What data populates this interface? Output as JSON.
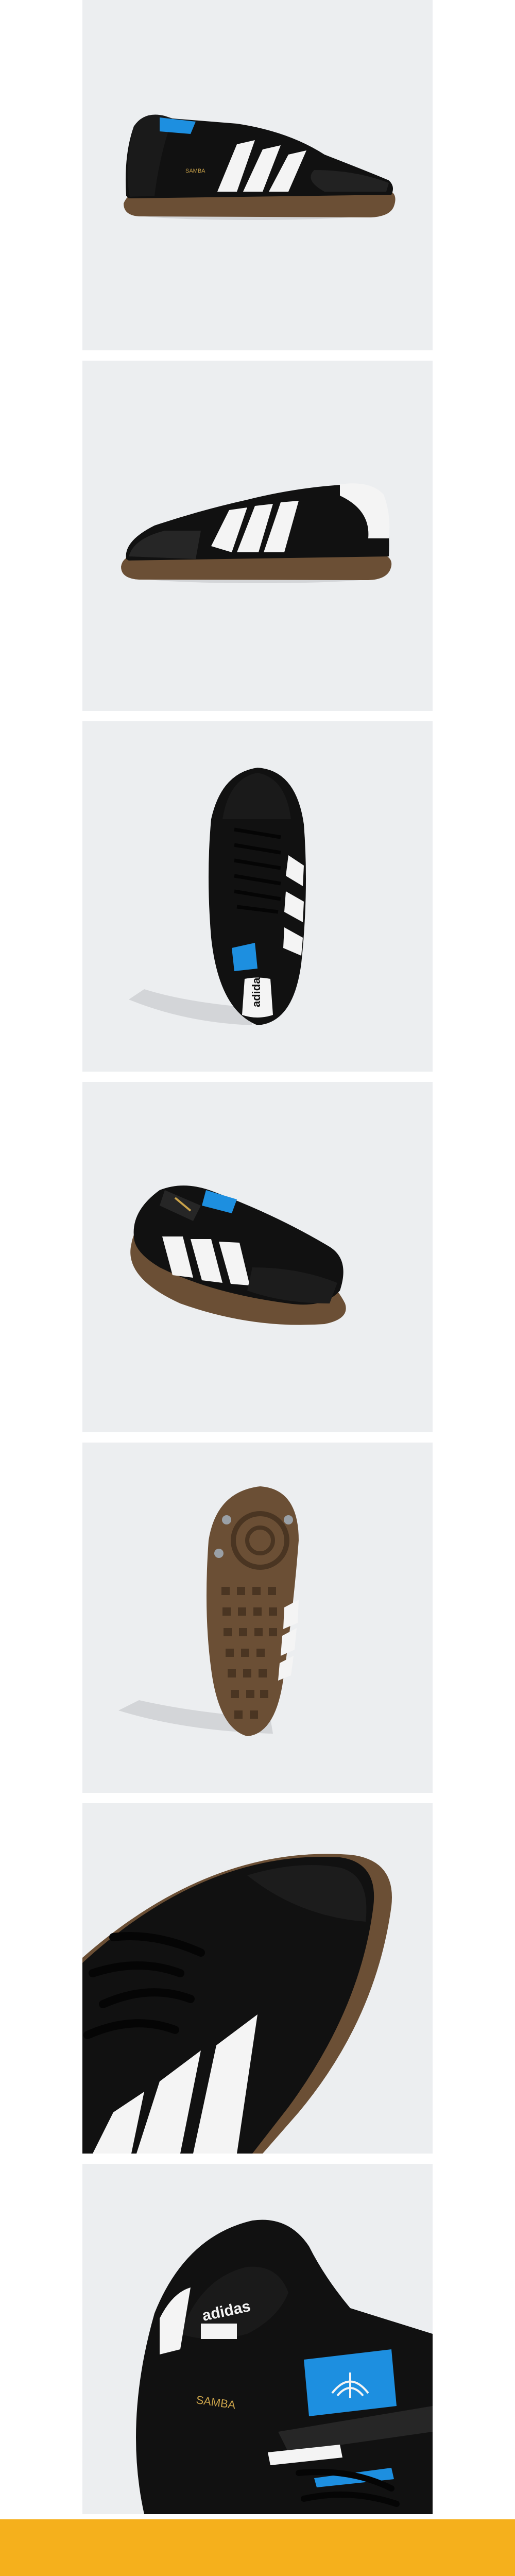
{
  "gallery": {
    "images": [
      {
        "name": "shoe-side-view-lateral"
      },
      {
        "name": "shoe-side-view-medial"
      },
      {
        "name": "shoe-top-view"
      },
      {
        "name": "shoe-front-three-quarter-view"
      },
      {
        "name": "shoe-outsole-view"
      },
      {
        "name": "shoe-detail-stripes"
      },
      {
        "name": "shoe-detail-tongue-heel"
      }
    ],
    "brand_text": "adidas",
    "model_text": "SAMBA",
    "colors": {
      "panel_background": "#eceef0",
      "upper_black": "#111111",
      "stripe_white": "#f4f4f4",
      "gum_sole": "#6b4f35",
      "tongue_blue": "#1d8fe0",
      "gold_text": "#c9a24a",
      "footer_accent": "#f5b01c"
    }
  }
}
